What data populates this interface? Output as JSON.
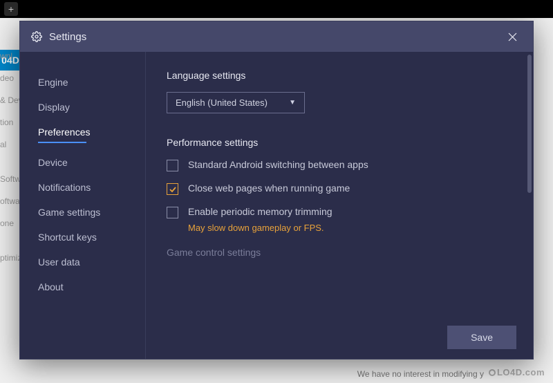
{
  "topbar": {
    "plus_label": "+"
  },
  "background": {
    "logo": "04D",
    "left_items": [
      "wnl",
      "deo",
      "& Dev",
      "tion",
      "al",
      "",
      "Softw",
      "oftwa",
      "one",
      "",
      "ptimization"
    ],
    "bottom_text": "We have no interest in modifying y",
    "watermark": "LO4D.com"
  },
  "modal": {
    "title": "Settings",
    "close_label": "×"
  },
  "sidebar": {
    "items": [
      {
        "label": "Engine",
        "active": false
      },
      {
        "label": "Display",
        "active": false
      },
      {
        "label": "Preferences",
        "active": true
      },
      {
        "label": "Device",
        "active": false
      },
      {
        "label": "Notifications",
        "active": false
      },
      {
        "label": "Game settings",
        "active": false
      },
      {
        "label": "Shortcut keys",
        "active": false
      },
      {
        "label": "User data",
        "active": false
      },
      {
        "label": "About",
        "active": false
      }
    ]
  },
  "content": {
    "lang_section_title": "Language settings",
    "lang_selected": "English (United States)",
    "perf_section_title": "Performance settings",
    "perf_options": [
      {
        "label": "Standard Android switching between apps",
        "checked": false
      },
      {
        "label": "Close web pages when running game",
        "checked": true
      },
      {
        "label": "Enable periodic memory trimming",
        "checked": false
      }
    ],
    "perf_hint": "May slow down gameplay or FPS.",
    "game_control_title": "Game control settings",
    "save_label": "Save"
  }
}
